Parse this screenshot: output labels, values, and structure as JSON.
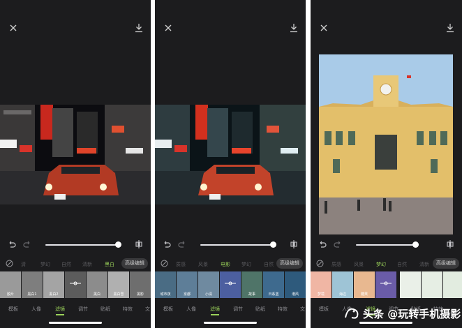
{
  "panels": [
    {
      "categories": [
        {
          "label": "清",
          "active": false
        },
        {
          "label": "梦幻",
          "active": false
        },
        {
          "label": "自然",
          "active": false
        },
        {
          "label": "清新",
          "active": false
        },
        {
          "label": "黑白",
          "active": true
        }
      ],
      "advanced": "高级编辑",
      "thumbs": [
        "胶片",
        "黑白1",
        "黑白2",
        "",
        "黑白",
        "黑白雪",
        "黑影",
        "黑"
      ],
      "tabs": [
        {
          "label": "模板",
          "active": false
        },
        {
          "label": "人像",
          "active": false
        },
        {
          "label": "滤镜",
          "active": true
        },
        {
          "label": "调节",
          "active": false
        },
        {
          "label": "贴纸",
          "active": false
        },
        {
          "label": "特效",
          "active": false
        },
        {
          "label": "文",
          "active": false
        }
      ],
      "slider_value": 1.0
    },
    {
      "categories": [
        {
          "label": "质感",
          "active": false
        },
        {
          "label": "风景",
          "active": false
        },
        {
          "label": "电影",
          "active": true
        },
        {
          "label": "梦幻",
          "active": false
        },
        {
          "label": "自然",
          "active": false
        }
      ],
      "advanced": "高级编辑",
      "thumbs": [
        "城市夜",
        "京都",
        "小清",
        "",
        "故事",
        "日系蓝",
        "港风",
        "霓"
      ],
      "tabs": [
        {
          "label": "模板",
          "active": false
        },
        {
          "label": "人像",
          "active": false
        },
        {
          "label": "滤镜",
          "active": true
        },
        {
          "label": "调节",
          "active": false
        },
        {
          "label": "贴纸",
          "active": false
        },
        {
          "label": "特效",
          "active": false
        },
        {
          "label": "文",
          "active": false
        }
      ],
      "slider_value": 1.0
    },
    {
      "categories": [
        {
          "label": "质感",
          "active": false
        },
        {
          "label": "风景",
          "active": false
        },
        {
          "label": "梦幻",
          "active": true
        },
        {
          "label": "自然",
          "active": false
        },
        {
          "label": "清新",
          "active": false
        }
      ],
      "advanced": "高级编辑",
      "thumbs": [
        "梦境",
        "海边",
        "糖果",
        "",
        "",
        "",
        ""
      ],
      "tabs": [
        {
          "label": "模板",
          "active": false
        },
        {
          "label": "人像",
          "active": false
        },
        {
          "label": "滤镜",
          "active": true
        },
        {
          "label": "调节",
          "active": false
        },
        {
          "label": "贴纸",
          "active": false
        },
        {
          "label": "特效",
          "active": false
        }
      ],
      "slider_value": 0.8
    }
  ],
  "watermark": "头条 @玩转手机摄影",
  "colors": {
    "panel_bg": "#1c1c1e",
    "accent": "#9bd35a",
    "sky": "#a9cbe8",
    "building": "#e3bf6a"
  }
}
